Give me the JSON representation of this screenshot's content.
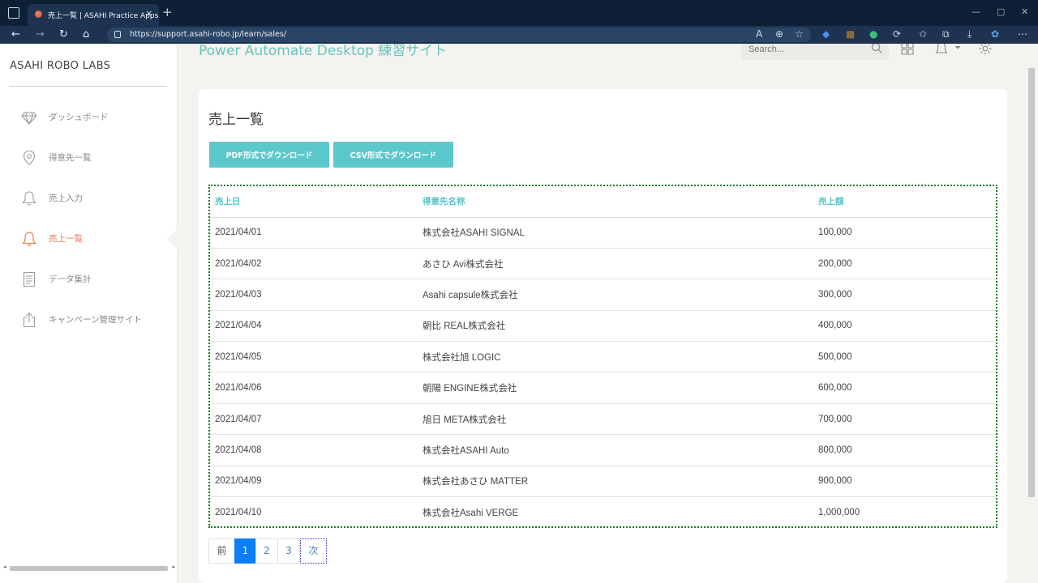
{
  "browser": {
    "tab_title": "売上一覧 | ASAHI Practice Apps",
    "url": "https://support.asahi-robo.jp/learn/sales/",
    "close_symbol": "×",
    "new_tab_symbol": "+"
  },
  "sidebar": {
    "brand": "ASAHI ROBO LABS",
    "items": [
      {
        "label": "ダッシュボード",
        "icon": "diamond-icon"
      },
      {
        "label": "得意先一覧",
        "icon": "location-pin-icon"
      },
      {
        "label": "売上入力",
        "icon": "bell-icon"
      },
      {
        "label": "売上一覧",
        "icon": "bell-icon",
        "active": true
      },
      {
        "label": "データ集計",
        "icon": "document-icon"
      },
      {
        "label": "キャンペーン管理サイト",
        "icon": "share-icon"
      }
    ]
  },
  "topnav": {
    "title": "Power Automate Desktop 練習サイト",
    "search_placeholder": "Search..."
  },
  "main": {
    "title": "売上一覧",
    "buttons": {
      "pdf": "PDF形式でダウンロード",
      "csv": "CSV形式でダウンロード"
    },
    "table": {
      "headers": [
        "売上日",
        "得意先名称",
        "売上額"
      ],
      "rows": [
        [
          "2021/04/01",
          "株式会社ASAHI SIGNAL",
          "100,000"
        ],
        [
          "2021/04/02",
          "あさひ Avi株式会社",
          "200,000"
        ],
        [
          "2021/04/03",
          "Asahi capsule株式会社",
          "300,000"
        ],
        [
          "2021/04/04",
          "朝比 REAL株式会社",
          "400,000"
        ],
        [
          "2021/04/05",
          "株式会社旭 LOGIC",
          "500,000"
        ],
        [
          "2021/04/06",
          "朝陽 ENGINE株式会社",
          "600,000"
        ],
        [
          "2021/04/07",
          "旭日 META株式会社",
          "700,000"
        ],
        [
          "2021/04/08",
          "株式会社ASAHI Auto",
          "800,000"
        ],
        [
          "2021/04/09",
          "株式会社あさひ MATTER",
          "900,000"
        ],
        [
          "2021/04/10",
          "株式会社Asahi VERGE",
          "1,000,000"
        ]
      ]
    },
    "pagination": {
      "prev": "前",
      "pages": [
        "1",
        "2",
        "3"
      ],
      "current": "1",
      "next": "次"
    }
  },
  "colors": {
    "accent": "#5bc8cc",
    "active_nav": "#ec7a53",
    "page_active": "#0d7ef5",
    "browser_dark": "#0d2036"
  }
}
